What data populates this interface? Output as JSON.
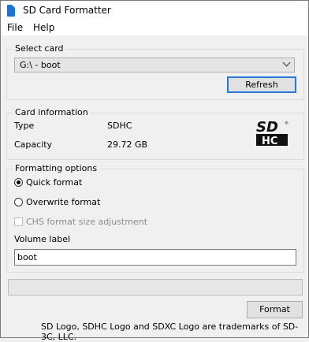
{
  "window": {
    "title": "SD Card Formatter"
  },
  "menu": {
    "file": "File",
    "help": "Help"
  },
  "select_card": {
    "legend": "Select card",
    "selected": "G:\\ - boot",
    "refresh_label": "Refresh"
  },
  "card_info": {
    "legend": "Card information",
    "type_label": "Type",
    "type_value": "SDHC",
    "capacity_label": "Capacity",
    "capacity_value": "29.72 GB",
    "logo": "sdhc-logo"
  },
  "options": {
    "legend": "Formatting options",
    "quick": "Quick format",
    "overwrite": "Overwrite format",
    "chs": "CHS format size adjustment",
    "selected": "quick",
    "chs_enabled": false,
    "volume_label_caption": "Volume label",
    "volume_label_value": "boot"
  },
  "progress": {
    "fraction": 0
  },
  "footer": {
    "format_label": "Format",
    "trademark": "SD Logo, SDHC Logo and SDXC Logo are trademarks of SD-3C, LLC."
  },
  "colors": {
    "accent": "#2a78d6",
    "icon": "#1a73d9"
  }
}
